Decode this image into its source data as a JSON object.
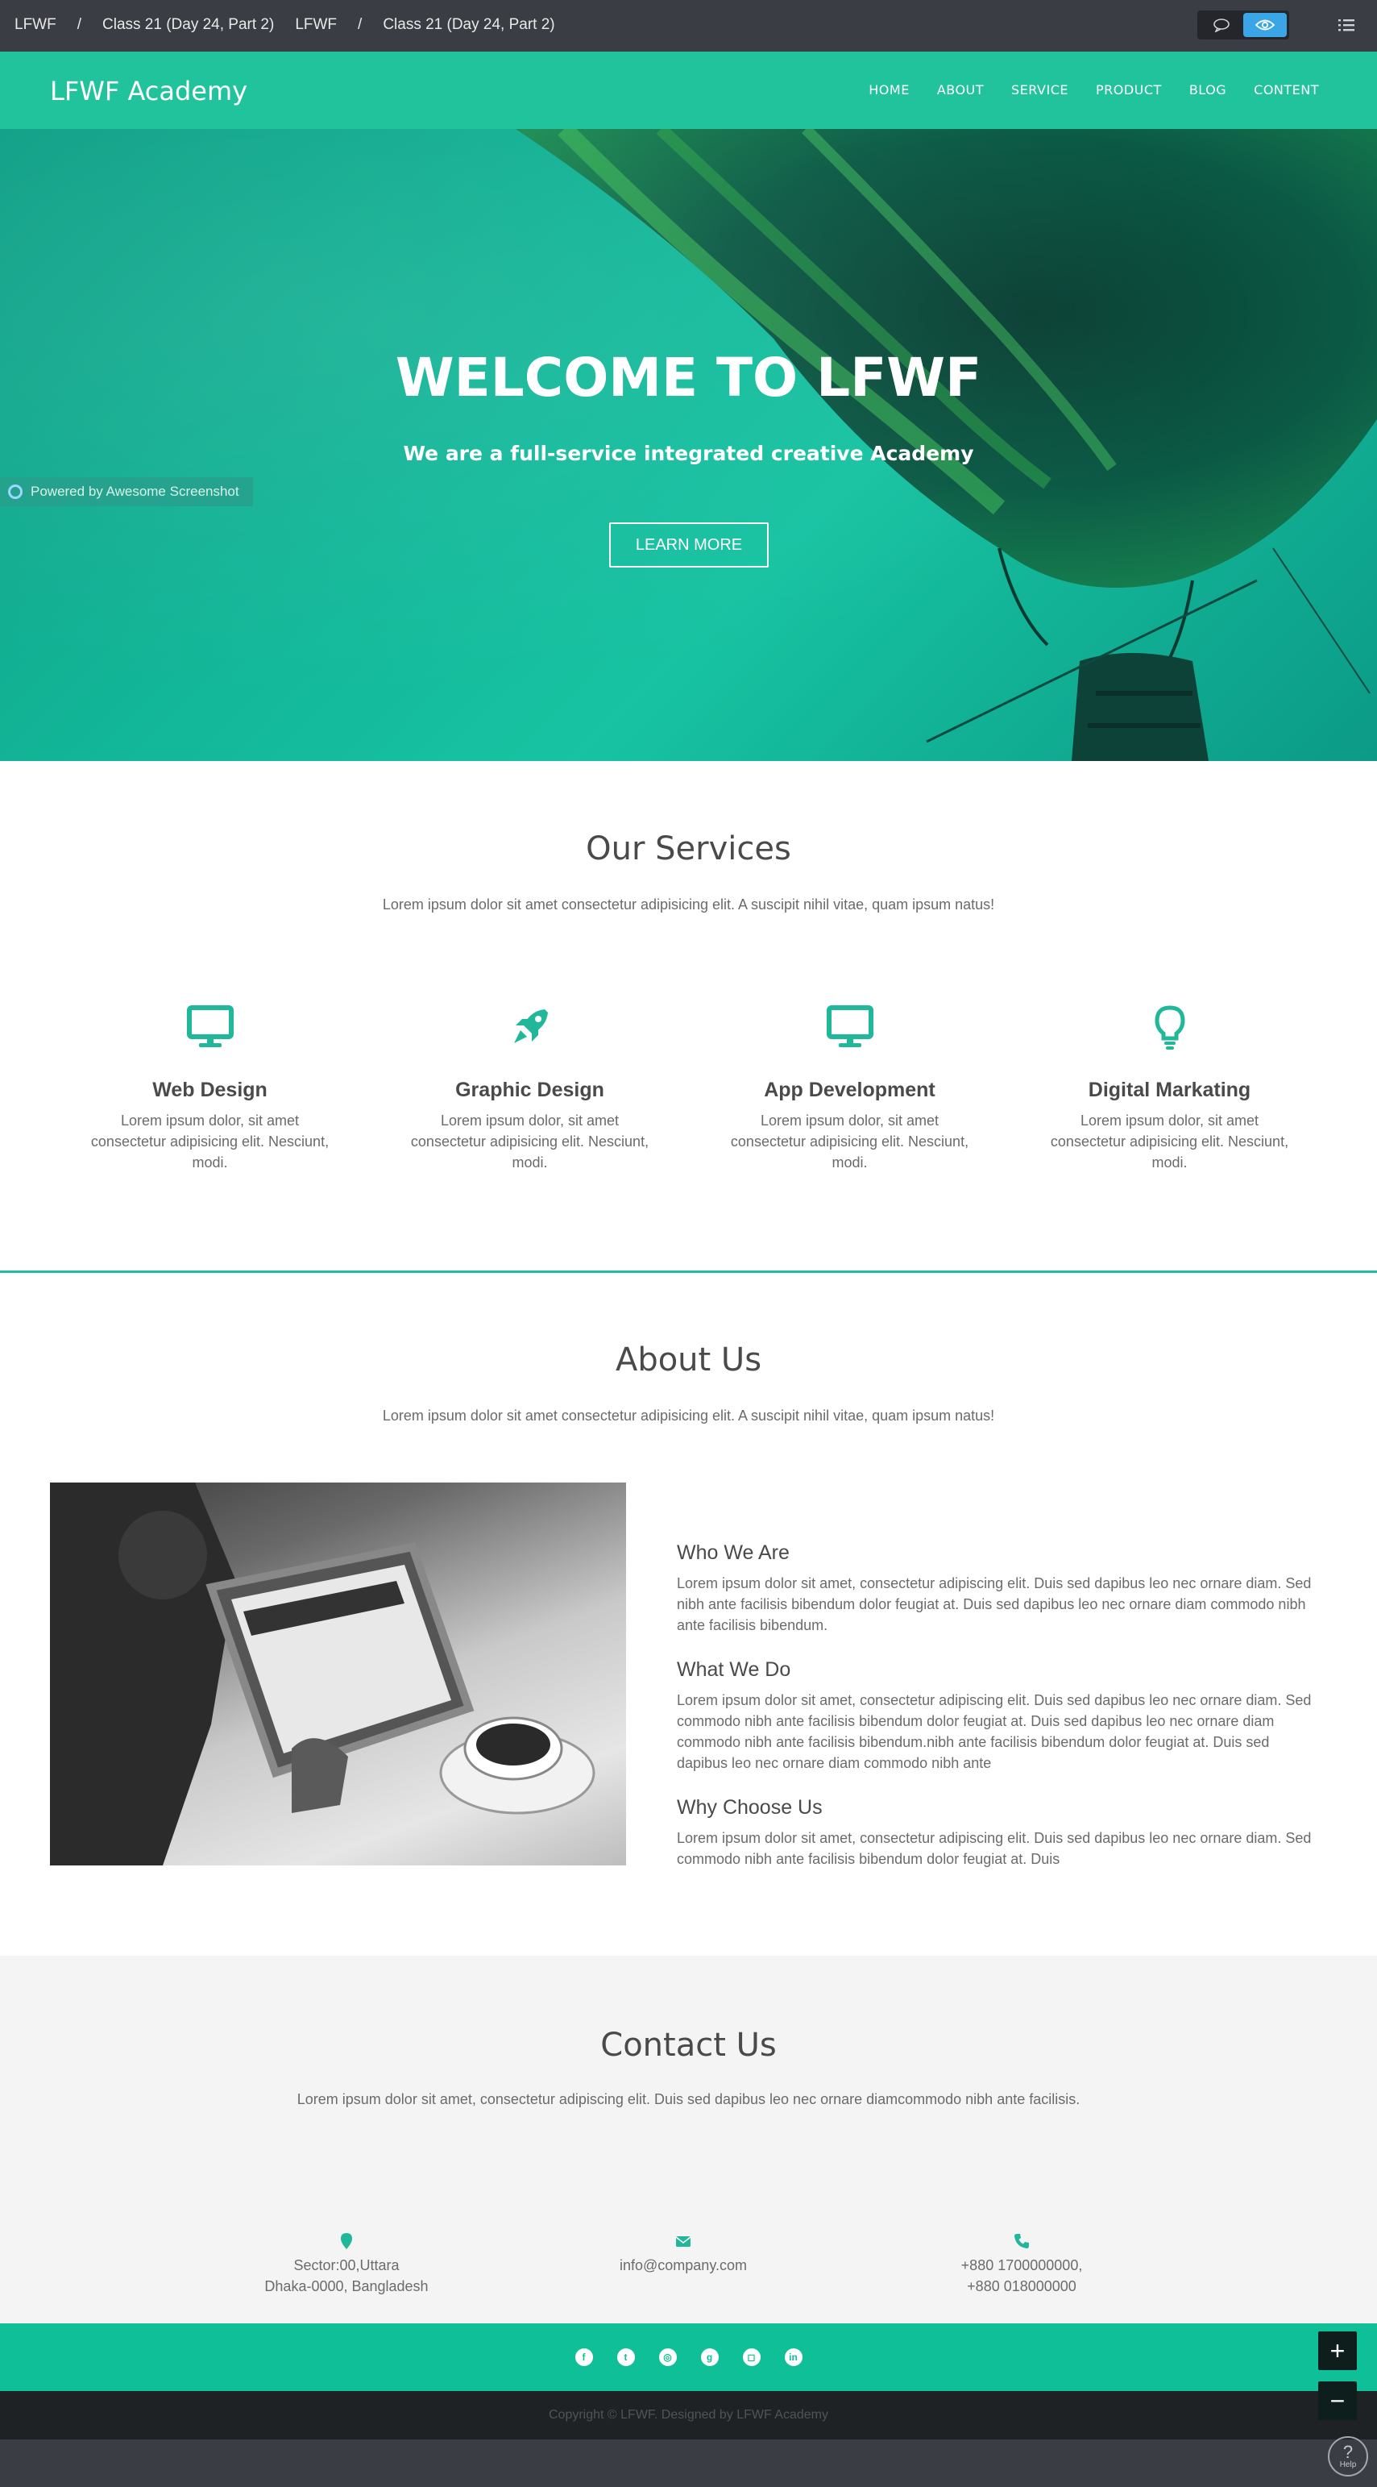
{
  "topbar": {
    "crumbs": [
      "LFWF",
      "/",
      "Class 21 (Day 24, Part 2)",
      "LFWF",
      "/",
      "Class 21 (Day 24, Part 2)"
    ]
  },
  "site": {
    "brand": "LFWF Academy",
    "menu": [
      "HOME",
      "ABOUT",
      "SERVICE",
      "PRODUCT",
      "BLOG",
      "CONTENT"
    ]
  },
  "hero": {
    "title": "WELCOME TO LFWF",
    "subtitle": "We are a full-service integrated creative Academy",
    "button": "LEARN MORE",
    "powered": "Powered by Awesome Screenshot"
  },
  "services": {
    "title": "Our Services",
    "subtitle": "Lorem ipsum dolor sit amet consectetur adipisicing elit. A suscipit nihil vitae, quam ipsum natus!",
    "items": [
      {
        "icon": "monitor-icon",
        "title": "Web Design",
        "text": "Lorem ipsum dolor, sit amet consectetur adipisicing elit. Nesciunt, modi."
      },
      {
        "icon": "rocket-icon",
        "title": "Graphic Design",
        "text": "Lorem ipsum dolor, sit amet consectetur adipisicing elit. Nesciunt, modi."
      },
      {
        "icon": "monitor-icon",
        "title": "App Development",
        "text": "Lorem ipsum dolor, sit amet consectetur adipisicing elit. Nesciunt, modi."
      },
      {
        "icon": "lightbulb-icon",
        "title": "Digital Markating",
        "text": "Lorem ipsum dolor, sit amet consectetur adipisicing elit. Nesciunt, modi."
      }
    ]
  },
  "about": {
    "title": "About Us",
    "subtitle": "Lorem ipsum dolor sit amet consectetur adipisicing elit. A suscipit nihil vitae, quam ipsum natus!",
    "blocks": [
      {
        "title": "Who We Are",
        "text": "Lorem ipsum dolor sit amet, consectetur adipiscing elit. Duis sed dapibus leo nec ornare diam. Sed nibh ante facilisis bibendum dolor feugiat at. Duis sed dapibus leo nec ornare diam commodo nibh ante facilisis bibendum."
      },
      {
        "title": "What We Do",
        "text": "Lorem ipsum dolor sit amet, consectetur adipiscing elit. Duis sed dapibus leo nec ornare diam. Sed commodo nibh ante facilisis bibendum dolor feugiat at. Duis sed dapibus leo nec ornare diam commodo nibh ante facilisis bibendum.nibh ante facilisis bibendum dolor feugiat at. Duis sed dapibus leo nec ornare diam commodo nibh ante"
      },
      {
        "title": "Why Choose Us",
        "text": "Lorem ipsum dolor sit amet, consectetur adipiscing elit. Duis sed dapibus leo nec ornare diam. Sed commodo nibh ante facilisis bibendum dolor feugiat at. Duis"
      }
    ]
  },
  "contact": {
    "title": "Contact Us",
    "subtitle": "Lorem ipsum dolor sit amet, consectetur adipiscing elit. Duis sed dapibus leo nec ornare diamcommodo nibh ante facilisis.",
    "address_line1": "Sector:00,Uttara",
    "address_line2": "Dhaka-0000, Bangladesh",
    "email": "info@company.com",
    "phone_line1": "+880 1700000000,",
    "phone_line2": "+880 018000000"
  },
  "footer": {
    "social": [
      "facebook-icon",
      "twitter-icon",
      "dribbble-icon",
      "github-icon",
      "instagram-icon",
      "linkedin-icon"
    ],
    "copyright": "Copyright © LFWF. Designed by LFWF Academy"
  },
  "controls": {
    "zoom_in": "+",
    "zoom_out": "−",
    "help": "?",
    "help_label": "Help"
  },
  "colors": {
    "accent": "#21c39d",
    "footer": "#0fbf97",
    "topbar": "#3a3d44"
  }
}
